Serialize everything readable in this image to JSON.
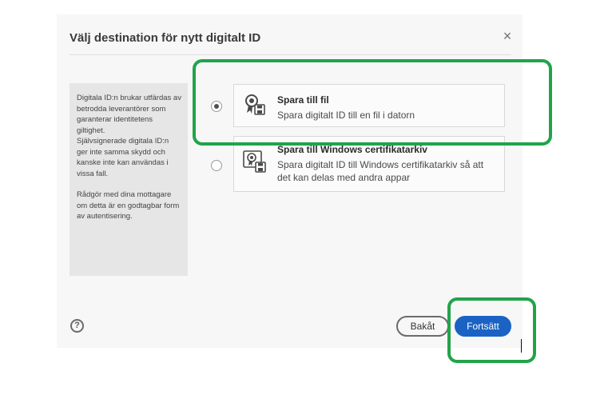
{
  "dialog": {
    "title": "Välj destination för nytt digitalt ID",
    "close_glyph": "×",
    "info_paragraph1": "Digitala ID:n brukar utfärdas av betrodda leverantörer som garanterar identitetens giltighet.",
    "info_paragraph2": "Självsignerade digitala ID:n ger inte samma skydd och kanske inte kan användas i vissa fall.",
    "info_paragraph3": "Rådgör med dina mottagare om detta är en godtagbar form av autentisering."
  },
  "options": [
    {
      "title": "Spara till fil",
      "description": "Spara digitalt ID till en fil i datorn",
      "icon": "certificate-file-icon",
      "selected": true
    },
    {
      "title": "Spara till Windows certifikatarkiv",
      "description": "Spara digitalt ID till Windows certifikatarkiv så att det kan delas med andra appar",
      "icon": "certificate-store-icon",
      "selected": false
    }
  ],
  "footer": {
    "help_glyph": "?",
    "back_label": "Bakåt",
    "continue_label": "Fortsätt"
  },
  "colors": {
    "highlight": "#22a34a",
    "primary_button": "#1a63c4",
    "dialog_background": "#f7f7f7",
    "info_panel": "#e6e6e6"
  }
}
